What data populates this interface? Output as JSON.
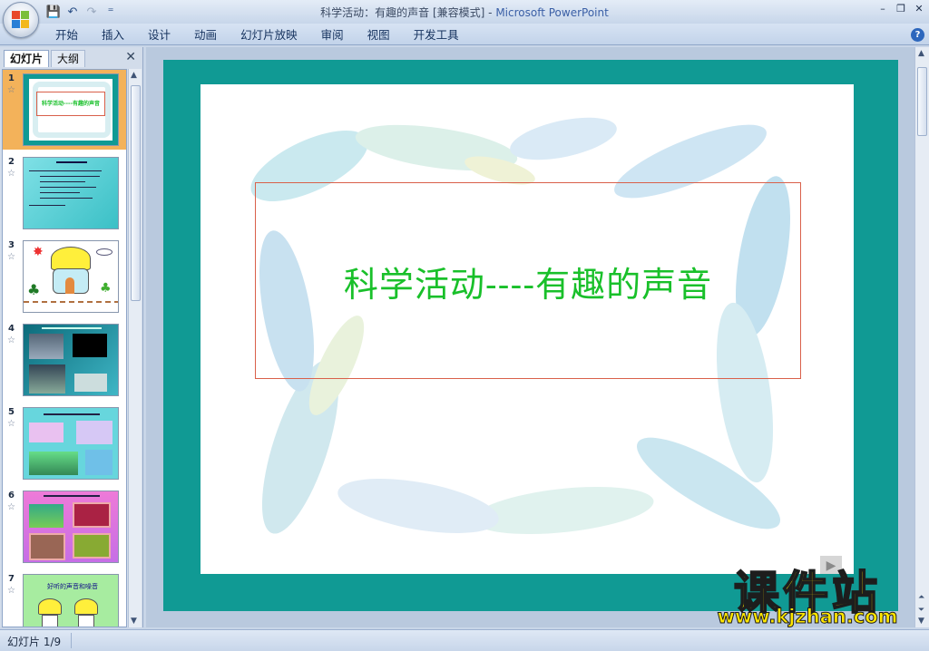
{
  "window": {
    "title": "科学活动：有趣的声音 [兼容模式]",
    "app_name": "Microsoft PowerPoint",
    "controls": [
      "–",
      "❐",
      "✕"
    ]
  },
  "quick_access": {
    "save_icon": "💾",
    "undo_icon": "↶",
    "redo_icon": "↷",
    "customize_icon": "⁼"
  },
  "ribbon": {
    "tabs": [
      "开始",
      "插入",
      "设计",
      "动画",
      "幻灯片放映",
      "审阅",
      "视图",
      "开发工具"
    ],
    "help_label": "?"
  },
  "left_pane": {
    "tab_slides": "幻灯片",
    "tab_outline": "大纲",
    "close_label": "✕",
    "thumbnails": [
      {
        "number": "1",
        "title_snippet": "科学活动----有趣的声音"
      },
      {
        "number": "2"
      },
      {
        "number": "3"
      },
      {
        "number": "4"
      },
      {
        "number": "5"
      },
      {
        "number": "6"
      },
      {
        "number": "7",
        "title_snippet": "好听的声音和噪音"
      }
    ],
    "star_glyph": "☆"
  },
  "slide": {
    "title": "科学活动----有趣的声音",
    "play_glyph": "▶"
  },
  "statusbar": {
    "slide_indicator": "幻灯片 1/9"
  },
  "watermark": {
    "brand": "课件站",
    "url": "www.kjzhan.com"
  },
  "colors": {
    "slide_bg": "#109a94",
    "title_color": "#19c02a",
    "selected_thumb": "#f3b25a"
  }
}
